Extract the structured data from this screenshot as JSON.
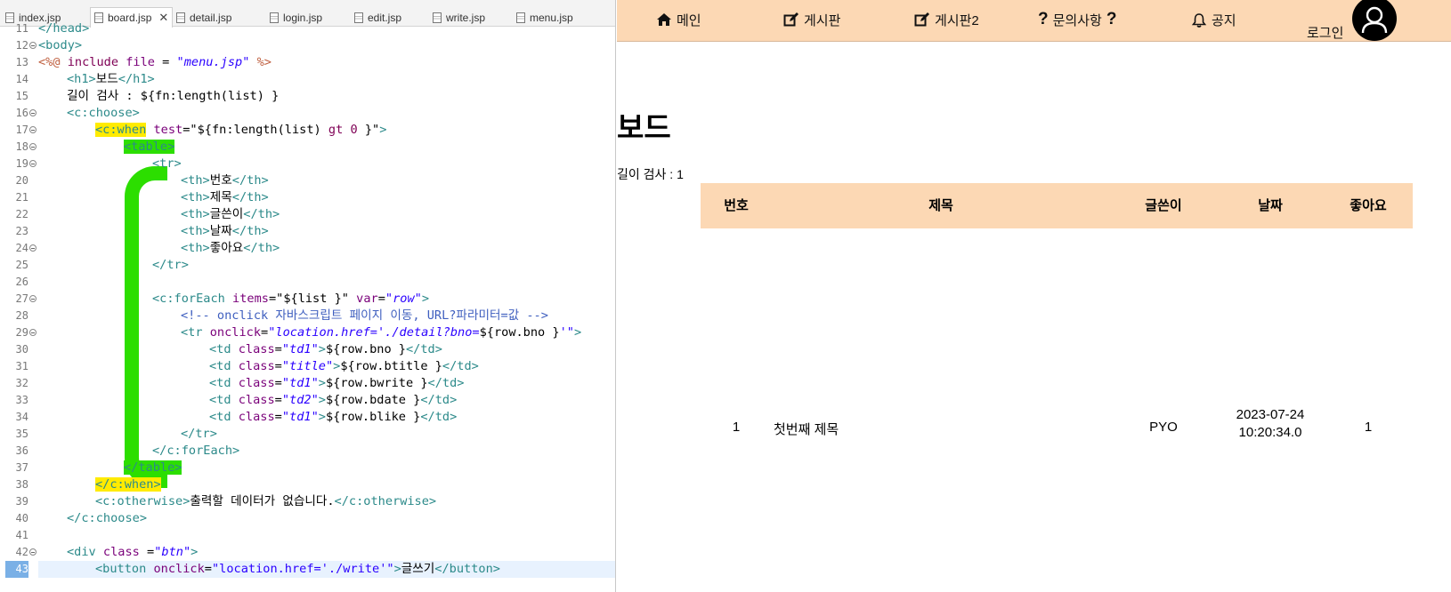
{
  "editor": {
    "tabs": [
      "index.jsp",
      "board.jsp",
      "detail.jsp",
      "login.jsp",
      "edit.jsp",
      "write.jsp",
      "menu.jsp"
    ],
    "active_tab": "board.jsp",
    "line_numbers": [
      "11",
      "12",
      "13",
      "14",
      "15",
      "16",
      "17",
      "18",
      "19",
      "20",
      "21",
      "22",
      "23",
      "24",
      "25",
      "26",
      "27",
      "28",
      "29",
      "30",
      "31",
      "32",
      "33",
      "34",
      "35",
      "36",
      "37",
      "38",
      "39",
      "40",
      "41",
      "42",
      "43"
    ],
    "code": {
      "l11": "</head>",
      "l12": "<body>",
      "l13_a": "<%@",
      "l13_b": " include ",
      "l13_c": "file",
      "l13_d": " = ",
      "l13_e": "\"menu.jsp\"",
      "l13_f": " %>",
      "l14_a": "<h1>",
      "l14_b": "보드",
      "l14_c": "</h1>",
      "l15": "길이 검사 : ${fn:length(list) }",
      "l16": "<c:choose>",
      "l17_a": "<c:when",
      "l17_b": " test",
      "l17_c": "=",
      "l17_d": "\"${fn:length(list) ",
      "l17_e": "gt 0",
      "l17_f": " }\"",
      "l17_g": ">",
      "l18": "<table>",
      "l19": "<tr>",
      "l20_a": "<th>",
      "l20_b": "번호",
      "l20_c": "</th>",
      "l21_b": "제목",
      "l22_b": "글쓴이",
      "l23_b": "날짜",
      "l24_b": "좋아요",
      "l25": "</tr>",
      "l27_a": "<c:forEach",
      "l27_b": " items",
      "l27_c": "=",
      "l27_d": "\"${list }\"",
      "l27_e": " var",
      "l27_f": "=",
      "l27_g": "\"row\"",
      "l27_h": ">",
      "l28": "<!-- onclick 자바스크립트 페이지 이동, URL?파라미터=값 -->",
      "l29_a": "<tr",
      "l29_b": " onclick",
      "l29_c": "=",
      "l29_d": "\"location.href='./detail?bno=",
      "l29_e": "${row.bno }",
      "l29_f": "'\"",
      "l29_g": ">",
      "l30_a": "<td",
      "l30_b": " class",
      "l30_c": "=",
      "l30_d": "\"td1\"",
      "l30_e": ">",
      "l30_f": "${row.bno }",
      "l30_g": "</td>",
      "l31_d": "\"title\"",
      "l31_f": "${row.btitle }",
      "l32_d": "\"td1\"",
      "l32_f": "${row.bwrite }",
      "l33_d": "\"td2\"",
      "l33_f": "${row.bdate }",
      "l34_d": "\"td1\"",
      "l34_f": "${row.blike }",
      "l35": "</tr>",
      "l36": "</c:forEach>",
      "l37": "</table>",
      "l38": "</c:when>",
      "l39_a": "<c:otherwise>",
      "l39_b": "출력할 데이터가 없습니다.",
      "l39_c": "</c:otherwise>",
      "l40": "</c:choose>",
      "l42_a": "<div",
      "l42_b": " class",
      "l42_c": " =",
      "l42_d": "\"btn\"",
      "l42_e": ">",
      "l43_a": "<button",
      "l43_b": " onclick",
      "l43_c": "=",
      "l43_d": "\"location.href='./write'\"",
      "l43_e": ">",
      "l43_f": "글쓰기",
      "l43_g": "</button>"
    }
  },
  "browser": {
    "nav": {
      "main": "메인",
      "board": "게시판",
      "board2": "게시판2",
      "qna": "문의사항",
      "notice": "공지",
      "login": "로그인",
      "q": "?"
    },
    "page_title": "보드",
    "length_text": "길이 검사 : 1",
    "table": {
      "headers": [
        "번호",
        "제목",
        "글쓴이",
        "날짜",
        "좋아요"
      ],
      "rows": [
        {
          "bno": "1",
          "title": "첫번째 제목",
          "writer": "PYO",
          "date_1": "2023-07-24",
          "date_2": "10:20:34.0",
          "like": "1"
        }
      ]
    }
  },
  "colors": {
    "nav_bg": "#fcd8b4",
    "highlight_yellow": "#ffeb00",
    "highlight_green": "#2cde00"
  }
}
